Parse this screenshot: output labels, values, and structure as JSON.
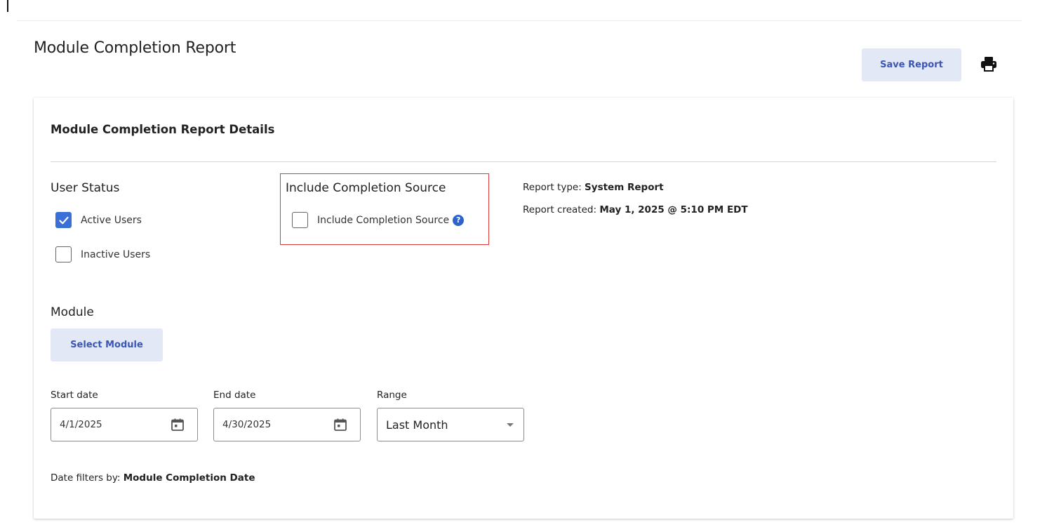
{
  "page": {
    "title": "Module Completion Report",
    "save_label": "Save Report",
    "print_icon": "printer-icon"
  },
  "card": {
    "title": "Module Completion Report Details",
    "user_status": {
      "heading": "User Status",
      "options": [
        {
          "label": "Active Users",
          "checked": true
        },
        {
          "label": "Inactive Users",
          "checked": false
        }
      ]
    },
    "completion_source": {
      "heading": "Include Completion Source",
      "checkbox_label": "Include Completion Source",
      "checked": false,
      "help_icon": "question-circle-icon",
      "help_glyph": "?"
    },
    "meta": {
      "report_type_label": "Report type:",
      "report_type_value": "System Report",
      "report_created_label": "Report created:",
      "report_created_value": "May 1, 2025 @ 5:10 PM EDT"
    },
    "module": {
      "heading": "Module",
      "select_label": "Select Module"
    },
    "dates": {
      "start_label": "Start date",
      "start_value": "4/1/2025",
      "end_label": "End date",
      "end_value": "4/30/2025",
      "range_label": "Range",
      "range_value": "Last Month"
    },
    "date_filter": {
      "label": "Date filters by:",
      "value": "Module Completion Date"
    }
  },
  "colors": {
    "accent": "#3a6fd8",
    "button_bg": "#e3e8f6",
    "button_text": "#3a56b4",
    "highlight": "#d93a3a"
  }
}
